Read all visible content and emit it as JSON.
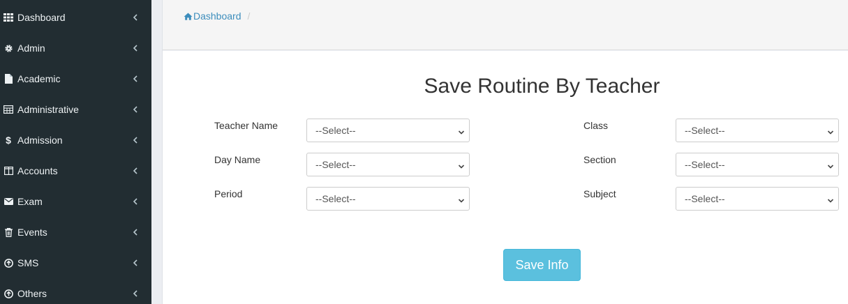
{
  "sidebar": {
    "items": [
      {
        "label": "Dashboard",
        "icon": "grid-icon"
      },
      {
        "label": "Admin",
        "icon": "gear-icon"
      },
      {
        "label": "Academic",
        "icon": "file-icon"
      },
      {
        "label": "Administrative",
        "icon": "table-icon"
      },
      {
        "label": "Admission",
        "icon": "dollar-icon"
      },
      {
        "label": "Accounts",
        "icon": "columns-icon"
      },
      {
        "label": "Exam",
        "icon": "envelope-icon"
      },
      {
        "label": "Events",
        "icon": "trash-icon"
      },
      {
        "label": "SMS",
        "icon": "circle-arrow-icon"
      },
      {
        "label": "Others",
        "icon": "circle-arrow-icon"
      }
    ]
  },
  "breadcrumb": {
    "home_label": "Dashboard",
    "separator": "/"
  },
  "form": {
    "title": "Save Routine By Teacher",
    "fields": {
      "teacher_name": {
        "label": "Teacher Name",
        "value": "--Select--"
      },
      "class": {
        "label": "Class",
        "value": "--Select--"
      },
      "day_name": {
        "label": "Day Name",
        "value": "--Select--"
      },
      "section": {
        "label": "Section",
        "value": "--Select--"
      },
      "period": {
        "label": "Period",
        "value": "--Select--"
      },
      "subject": {
        "label": "Subject",
        "value": "--Select--"
      }
    },
    "save_label": "Save Info"
  },
  "colors": {
    "sidebar_bg": "#222d32",
    "link": "#3c8dbc",
    "button_bg": "#5bc0de"
  }
}
